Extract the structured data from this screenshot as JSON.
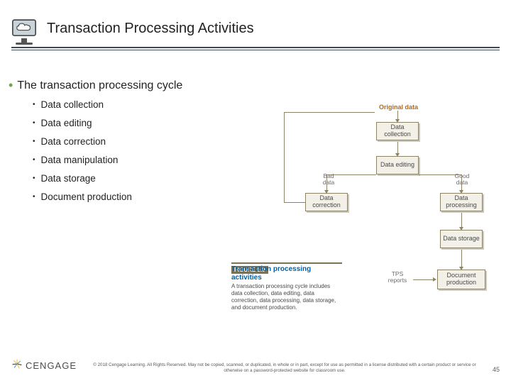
{
  "header": {
    "title": "Transaction Processing Activities"
  },
  "bullets": {
    "l1": "The transaction processing cycle",
    "items": [
      "Data collection",
      "Data editing",
      "Data correction",
      "Data manipulation",
      "Data storage",
      "Document production"
    ]
  },
  "diagram": {
    "original_data": "Original data",
    "data_collection": "Data collection",
    "data_editing": "Data editing",
    "bad_data": "Bad data",
    "good_data": "Good data",
    "data_correction": "Data correction",
    "data_processing": "Data processing",
    "data_storage": "Data storage",
    "tps_reports": "TPS reports",
    "document_production": "Document production"
  },
  "figcap": {
    "num": "FIGURE 5.9",
    "title": "Transaction processing activities",
    "body": "A transaction processing cycle includes data collection, data editing, data correction, data processing, data storage, and document production."
  },
  "footer": {
    "brand": "CENGAGE",
    "copyright": "© 2018 Cengage Learning. All Rights Reserved. May not be copied, scanned, or duplicated, in whole or in part, except for use as permitted in a license distributed with a certain product or service or otherwise on a password-protected website for classroom use.",
    "page": "45"
  }
}
